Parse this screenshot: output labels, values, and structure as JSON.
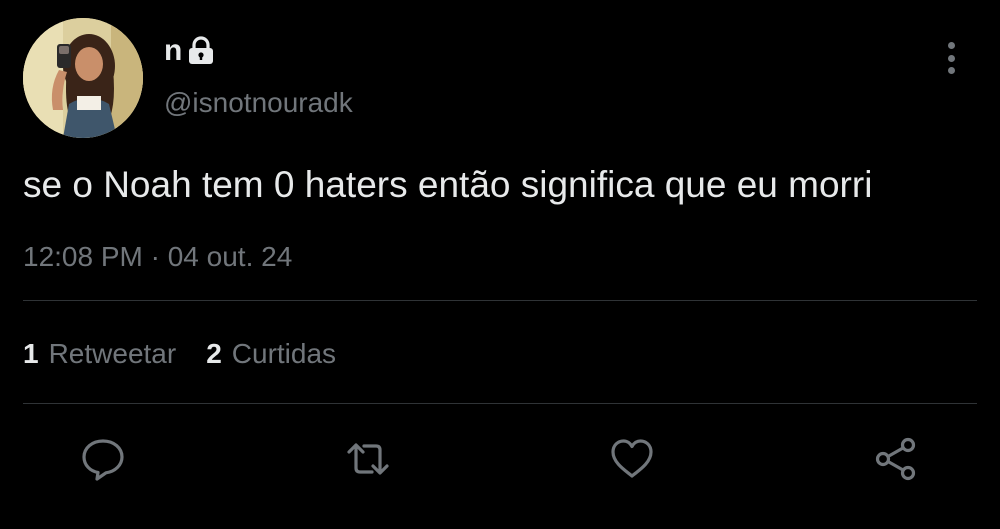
{
  "author": {
    "display_name": "n",
    "handle": "@isnotnouradk",
    "protected_icon": "lock-icon",
    "avatar": "profile-photo"
  },
  "tweet": {
    "text": "se o Noah tem 0 haters então significa que eu morri",
    "timestamp": "12:08 PM · 04 out. 24"
  },
  "stats": {
    "retweets": {
      "count": "1",
      "label": "Retweetar"
    },
    "likes": {
      "count": "2",
      "label": "Curtidas"
    }
  },
  "actions": [
    {
      "name": "reply",
      "icon": "reply-icon"
    },
    {
      "name": "retweet",
      "icon": "retweet-icon"
    },
    {
      "name": "like",
      "icon": "heart-icon"
    },
    {
      "name": "share",
      "icon": "share-icon"
    }
  ],
  "colors": {
    "background": "#000000",
    "primary_text": "#e7e9ea",
    "secondary_text": "#71767b",
    "divider": "#2f3336"
  }
}
